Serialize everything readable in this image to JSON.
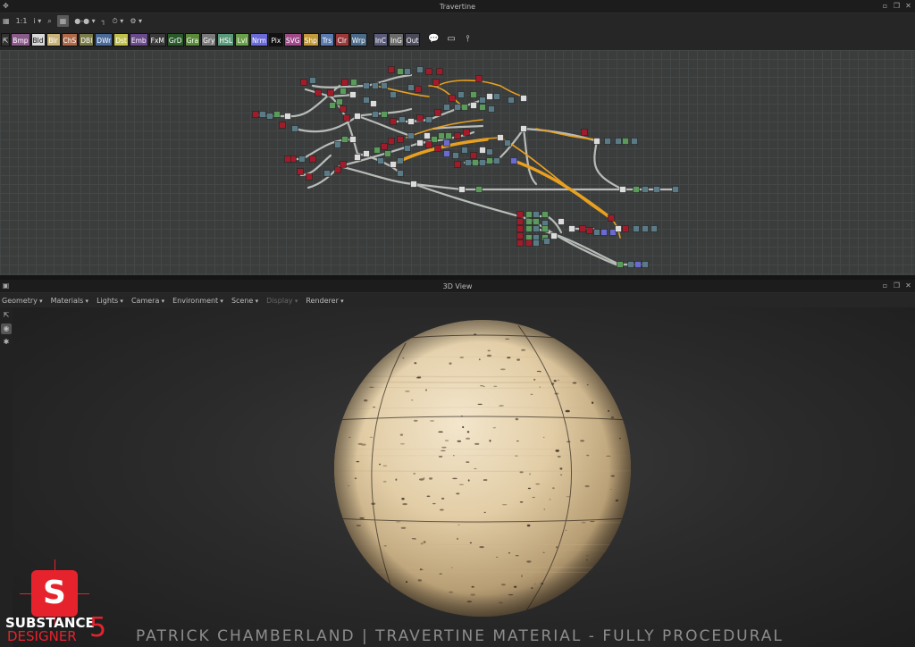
{
  "graph_window": {
    "title": "Travertine"
  },
  "graph_toolbar": {
    "items": [
      {
        "name": "frame-icon",
        "glyph": "▦"
      },
      {
        "name": "fit-label",
        "glyph": "1:1"
      },
      {
        "name": "info-icon",
        "glyph": "i ▾"
      },
      {
        "name": "search-icon",
        "glyph": "⌕"
      },
      {
        "name": "grid-icon",
        "glyph": "▦"
      },
      {
        "name": "link-style-icon",
        "glyph": "●-● ▾"
      },
      {
        "name": "align-icon",
        "glyph": "┐"
      },
      {
        "name": "timer-icon",
        "glyph": "⏱ ▾"
      },
      {
        "name": "settings-icon",
        "glyph": "⚙ ▾"
      }
    ]
  },
  "library_buttons": [
    {
      "label": "Bmp",
      "color": "#8a5a8a"
    },
    {
      "label": "Bld",
      "color": "#d8d8d8"
    },
    {
      "label": "Blr",
      "color": "#c8b47a"
    },
    {
      "label": "ChS",
      "color": "#b06a4a"
    },
    {
      "label": "DBl",
      "color": "#7a7a4a"
    },
    {
      "label": "DWr",
      "color": "#4a6a9a"
    },
    {
      "label": "Dst",
      "color": "#c0c04a"
    },
    {
      "label": "Emb",
      "color": "#6a4a8a"
    },
    {
      "label": "FxM",
      "color": "#3a3a3a"
    },
    {
      "label": "GrD",
      "color": "#2a5a2a"
    },
    {
      "label": "Gra",
      "color": "#5a8a3a"
    },
    {
      "label": "Gry",
      "color": "#7a7a7a"
    },
    {
      "label": "HSL",
      "color": "#5a9a7a"
    },
    {
      "label": "Lvl",
      "color": "#6aa04a"
    },
    {
      "label": "Nrm",
      "color": "#6a6ad8"
    },
    {
      "label": "Pix",
      "color": "#111111"
    },
    {
      "label": "SVG",
      "color": "#a04a8a"
    },
    {
      "label": "Shp",
      "color": "#c09a3a"
    },
    {
      "label": "Trs",
      "color": "#5a7ab0"
    },
    {
      "label": "Clr",
      "color": "#9a3a3a"
    },
    {
      "label": "Wrp",
      "color": "#4a6a8a"
    },
    {
      "label": "InC",
      "color": "#5a5a7a"
    },
    {
      "label": "InG",
      "color": "#6a6a6a"
    },
    {
      "label": "Out",
      "color": "#4a4a5a"
    }
  ],
  "view_window": {
    "title": "3D View"
  },
  "view_toolbar": {
    "items": [
      {
        "label": "Geometry",
        "enabled": true
      },
      {
        "label": "Materials",
        "enabled": true
      },
      {
        "label": "Lights",
        "enabled": true
      },
      {
        "label": "Camera",
        "enabled": true
      },
      {
        "label": "Environment",
        "enabled": true
      },
      {
        "label": "Scene",
        "enabled": true
      },
      {
        "label": "Display",
        "enabled": false
      },
      {
        "label": "Renderer",
        "enabled": true
      }
    ]
  },
  "side_tools": [
    {
      "name": "export-icon",
      "glyph": "⇱"
    },
    {
      "name": "camera-icon",
      "glyph": "◉"
    },
    {
      "name": "light-icon",
      "glyph": "✱"
    }
  ],
  "logo": {
    "line1": "SUBSTANCE",
    "line2": "DESIGNER",
    "number": "5",
    "letter": "S"
  },
  "caption": "PATRICK CHAMBERLAND | TRAVERTINE MATERIAL - FULLY PROCEDURAL",
  "colors": {
    "node_red": "#a01c2a",
    "node_green": "#5a9a5a",
    "node_gray": "#5a7a86",
    "node_white": "#dcdcdc",
    "node_blue": "#6a6ad0",
    "link_gray": "#b8bcb8",
    "link_orange": "#e8a020",
    "sphere_base": "#e8d4b0",
    "logo_red": "#e6232d"
  }
}
